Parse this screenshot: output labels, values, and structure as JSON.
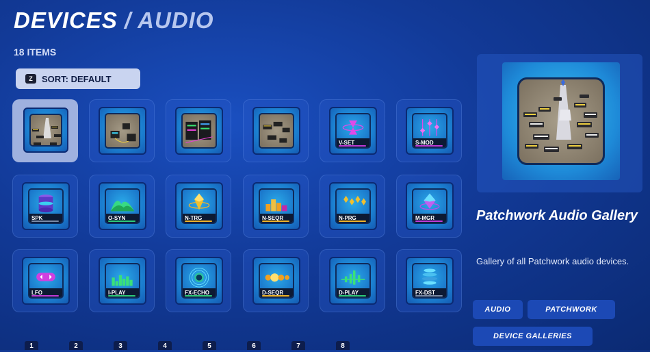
{
  "header": {
    "title_main": "DEVICES",
    "title_sep": "/",
    "title_sub": "AUDIO",
    "item_count": "18 ITEMS"
  },
  "sort": {
    "key": "Z",
    "label": "SORT: DEFAULT"
  },
  "grid": {
    "selected_index": 0,
    "items": [
      {
        "label": "",
        "art": "patchwork-gallery-scene"
      },
      {
        "label": "",
        "art": "device-cluster-scene"
      },
      {
        "label": "",
        "art": "synth-rack-scene"
      },
      {
        "label": "",
        "art": "devices-scene"
      },
      {
        "label": "V-SET",
        "art": "hourglass-ring-icon",
        "accent": "#c03ad8"
      },
      {
        "label": "S-MOD",
        "art": "sliders-icon",
        "accent": "#c03ad8"
      },
      {
        "label": "SPK",
        "art": "speaker-stack-icon",
        "accent": "#7a8ba8"
      },
      {
        "label": "O-SYN",
        "art": "waveform-hills-icon",
        "accent": "#2ecb7a"
      },
      {
        "label": "N-TRG",
        "art": "gold-gem-ring-icon",
        "accent": "#f0b428"
      },
      {
        "label": "N-SEQR",
        "art": "bar-blocks-icon",
        "accent": "#f0b428"
      },
      {
        "label": "N-PRG",
        "art": "diamond-row-icon",
        "accent": "#f0b428"
      },
      {
        "label": "M-MGR",
        "art": "purple-gem-icon",
        "accent": "#c03ad8"
      },
      {
        "label": "LFO",
        "art": "lfo-capsule-icon",
        "accent": "#c03ad8"
      },
      {
        "label": "I-PLAY",
        "art": "equalizer-bars-icon",
        "accent": "#2ecb7a"
      },
      {
        "label": "FX-ECHO",
        "art": "echo-rings-icon",
        "accent": "#2ecb7a"
      },
      {
        "label": "D-SEQR",
        "art": "step-dots-icon",
        "accent": "#f0b428"
      },
      {
        "label": "D-PLAY",
        "art": "beat-bars-icon",
        "accent": "#2ecb7a"
      },
      {
        "label": "FX-DST",
        "art": "distortion-disc-icon",
        "accent": "#7a8ba8"
      }
    ]
  },
  "pagination": {
    "pages": [
      "1",
      "2",
      "3",
      "4",
      "5",
      "6",
      "7",
      "8"
    ]
  },
  "detail": {
    "title": "Patchwork Audio Gallery",
    "description": "Gallery of all Patchwork audio devices.",
    "tags": [
      "AUDIO",
      "PATCHWORK",
      "DEVICE GALLERIES"
    ],
    "preview_art": "patchwork-gallery-scene"
  }
}
